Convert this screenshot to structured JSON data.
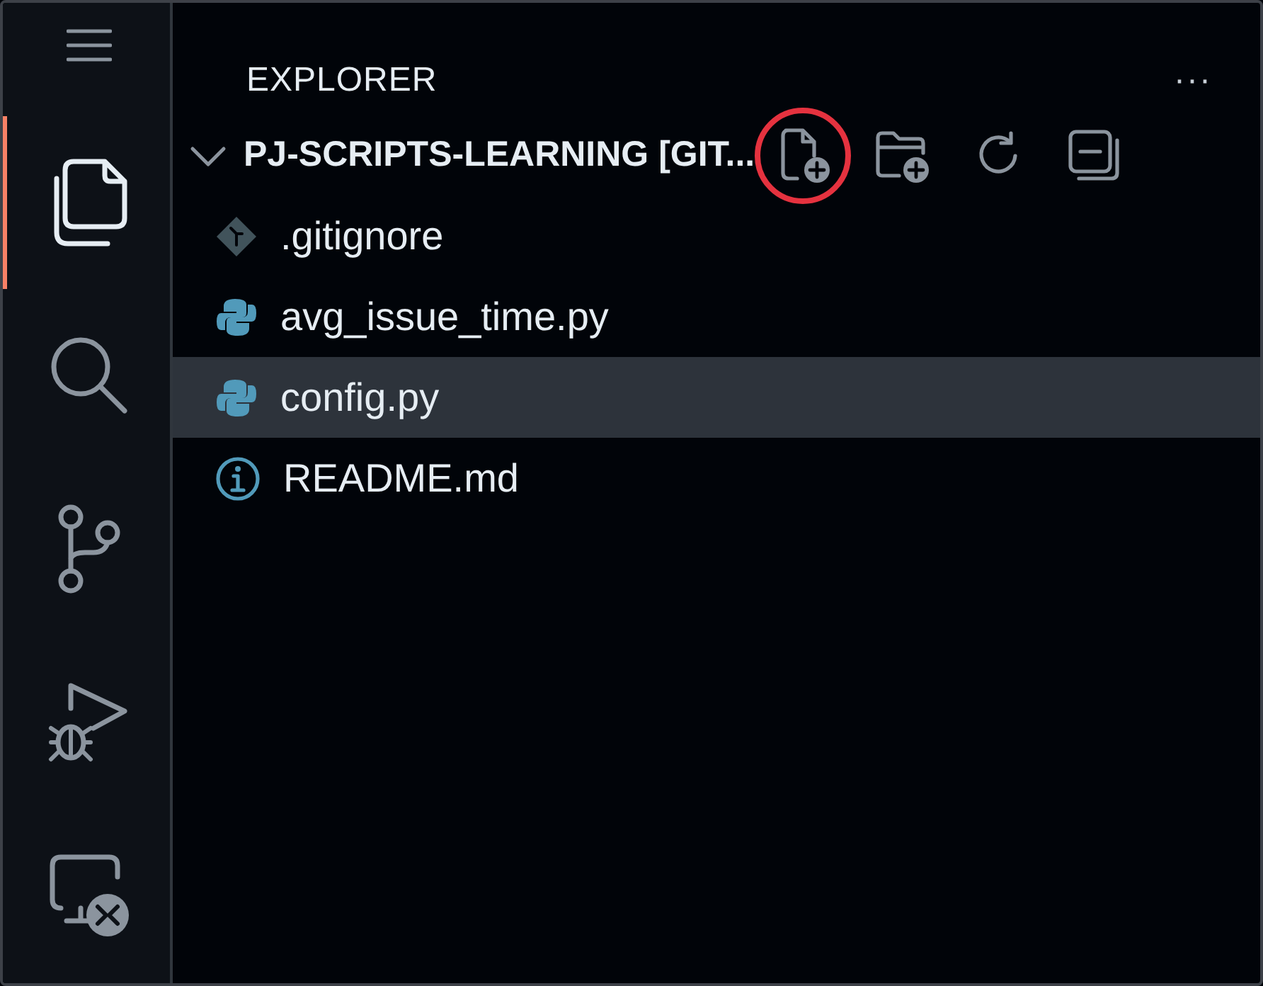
{
  "activity_bar": {
    "items": [
      {
        "kind": "menu",
        "selected": false
      },
      {
        "kind": "explorer",
        "selected": true
      },
      {
        "kind": "search",
        "selected": false
      },
      {
        "kind": "source-control",
        "selected": false
      },
      {
        "kind": "run-debug",
        "selected": false
      },
      {
        "kind": "remote",
        "selected": false
      }
    ]
  },
  "sidebar": {
    "title": "EXPLORER",
    "more": "···",
    "folder": {
      "name": "PJ-SCRIPTS-LEARNING [GIT...",
      "expanded": true,
      "actions": [
        {
          "kind": "new-file",
          "highlighted": true
        },
        {
          "kind": "new-folder",
          "highlighted": false
        },
        {
          "kind": "refresh",
          "highlighted": false
        },
        {
          "kind": "collapse",
          "highlighted": false
        }
      ],
      "files": [
        {
          "name": ".gitignore",
          "kind": "git",
          "selected": false
        },
        {
          "name": "avg_issue_time.py",
          "kind": "python",
          "selected": false
        },
        {
          "name": "config.py",
          "kind": "python",
          "selected": true
        },
        {
          "name": "README.md",
          "kind": "info",
          "selected": false
        }
      ]
    }
  }
}
